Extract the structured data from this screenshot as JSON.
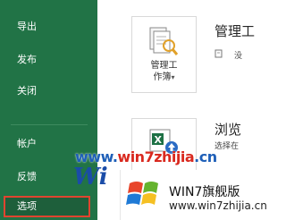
{
  "nav": {
    "items": [
      {
        "label": "导出"
      },
      {
        "label": "发布"
      },
      {
        "label": "关闭"
      },
      {
        "label": "帐户"
      },
      {
        "label": "反馈"
      },
      {
        "label": "选项"
      }
    ],
    "selected_index": 5
  },
  "content": {
    "manage": {
      "tile_label_line1": "管理工",
      "tile_label_line2": "作簿",
      "tile_dropdown": "▾",
      "heading": "管理工",
      "sub": "没"
    },
    "browse": {
      "heading": "浏览",
      "sub": "选择在"
    }
  },
  "watermark": {
    "url_blue1": "www.",
    "url_red": "win7zhijia",
    "url_blue2": ".cn",
    "brand": "Wi",
    "text": "WIN7旗舰版",
    "site": "www.win7zhijia.cn"
  },
  "colors": {
    "nav_bg": "#217346",
    "nav_selected_border": "#e0452f"
  }
}
